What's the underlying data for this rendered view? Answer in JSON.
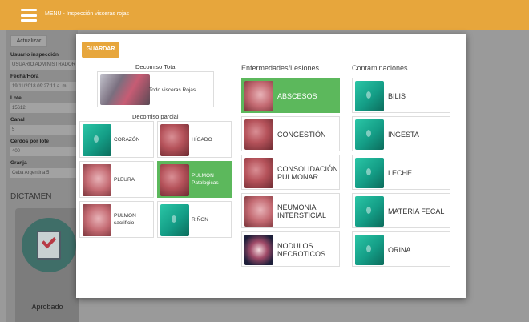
{
  "topbar": {
    "title": "MENÚ - Inspección visceras rojas"
  },
  "left_panel": {
    "refresh_label": "Actualizar",
    "fields": [
      {
        "label": "Usuario inspección",
        "value": "USUARIO ADMINISTRADOR"
      },
      {
        "label": "Fecha/Hora",
        "value": "19/11/2018 09:27:11 a. m."
      },
      {
        "label": "Lote",
        "value": "15612"
      },
      {
        "label": "Canal",
        "value": "5"
      },
      {
        "label": "Cerdos por lote",
        "value": "400"
      },
      {
        "label": "Granja",
        "value": "Ceba Argentina 5"
      }
    ],
    "dictamen_label": "DICTAMEN",
    "approve_label": "Aprobado"
  },
  "modal": {
    "save_label": "GUARDAR",
    "decomiso_total_title": "Decomiso Total",
    "decomiso_total_item": "Todo visceras Rojas",
    "decomiso_parcial_title": "Decomiso parcial",
    "parcial_items": [
      {
        "label": "CORAZÓN",
        "selected": false,
        "icon": "green-placeholder-icon"
      },
      {
        "label": "HÍGADO",
        "selected": false,
        "icon": "liver-photo"
      },
      {
        "label": "PLEURA",
        "selected": false,
        "icon": "pleura-photo"
      },
      {
        "label": "PULMON Patologicas",
        "selected": true,
        "icon": "lung-photo"
      },
      {
        "label": "PULMON sacrificio",
        "selected": false,
        "icon": "lung-photo"
      },
      {
        "label": "RIÑON",
        "selected": false,
        "icon": "green-placeholder-icon"
      }
    ],
    "diseases_title": "Enfermedades/Lesiones",
    "diseases": [
      {
        "label": "ABSCESOS",
        "selected": true
      },
      {
        "label": "CONGESTIÓN",
        "selected": false
      },
      {
        "label": "CONSOLIDACIÓN PULMONAR",
        "selected": false
      },
      {
        "label": "NEUMONIA INTERSTICIAL",
        "selected": false
      },
      {
        "label": "NODULOS NECROTICOS",
        "selected": false
      }
    ],
    "contamination_title": "Contaminaciones",
    "contaminations": [
      {
        "label": "BILIS",
        "selected": false
      },
      {
        "label": "INGESTA",
        "selected": false
      },
      {
        "label": "LECHE",
        "selected": false
      },
      {
        "label": "MATERIA FECAL",
        "selected": false
      },
      {
        "label": "ORINA",
        "selected": false
      }
    ]
  },
  "colors": {
    "accent": "#e7a63c",
    "selected": "#5cb85c",
    "overlay": "#9a9a9a"
  }
}
